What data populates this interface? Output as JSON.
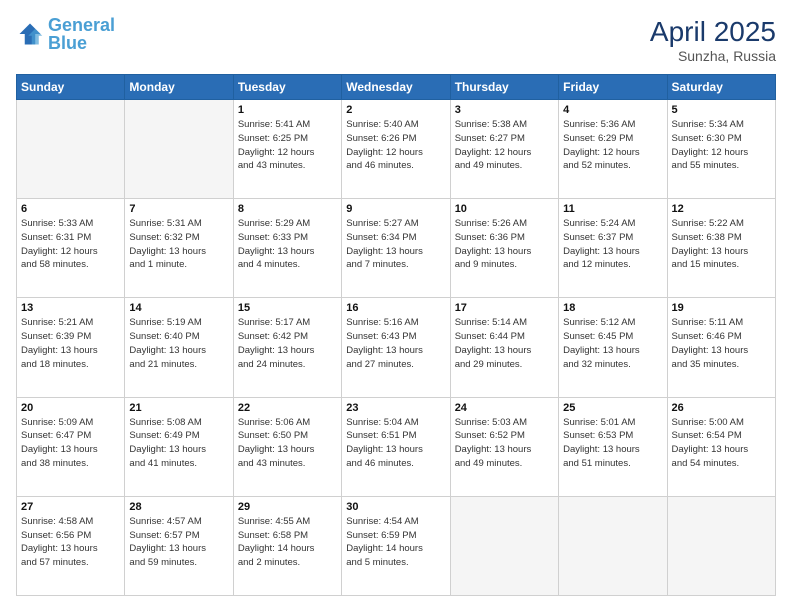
{
  "logo": {
    "line1": "General",
    "line2": "Blue"
  },
  "title": {
    "month_year": "April 2025",
    "location": "Sunzha, Russia"
  },
  "days_of_week": [
    "Sunday",
    "Monday",
    "Tuesday",
    "Wednesday",
    "Thursday",
    "Friday",
    "Saturday"
  ],
  "weeks": [
    [
      {
        "day": "",
        "info": ""
      },
      {
        "day": "",
        "info": ""
      },
      {
        "day": "1",
        "info": "Sunrise: 5:41 AM\nSunset: 6:25 PM\nDaylight: 12 hours\nand 43 minutes."
      },
      {
        "day": "2",
        "info": "Sunrise: 5:40 AM\nSunset: 6:26 PM\nDaylight: 12 hours\nand 46 minutes."
      },
      {
        "day": "3",
        "info": "Sunrise: 5:38 AM\nSunset: 6:27 PM\nDaylight: 12 hours\nand 49 minutes."
      },
      {
        "day": "4",
        "info": "Sunrise: 5:36 AM\nSunset: 6:29 PM\nDaylight: 12 hours\nand 52 minutes."
      },
      {
        "day": "5",
        "info": "Sunrise: 5:34 AM\nSunset: 6:30 PM\nDaylight: 12 hours\nand 55 minutes."
      }
    ],
    [
      {
        "day": "6",
        "info": "Sunrise: 5:33 AM\nSunset: 6:31 PM\nDaylight: 12 hours\nand 58 minutes."
      },
      {
        "day": "7",
        "info": "Sunrise: 5:31 AM\nSunset: 6:32 PM\nDaylight: 13 hours\nand 1 minute."
      },
      {
        "day": "8",
        "info": "Sunrise: 5:29 AM\nSunset: 6:33 PM\nDaylight: 13 hours\nand 4 minutes."
      },
      {
        "day": "9",
        "info": "Sunrise: 5:27 AM\nSunset: 6:34 PM\nDaylight: 13 hours\nand 7 minutes."
      },
      {
        "day": "10",
        "info": "Sunrise: 5:26 AM\nSunset: 6:36 PM\nDaylight: 13 hours\nand 9 minutes."
      },
      {
        "day": "11",
        "info": "Sunrise: 5:24 AM\nSunset: 6:37 PM\nDaylight: 13 hours\nand 12 minutes."
      },
      {
        "day": "12",
        "info": "Sunrise: 5:22 AM\nSunset: 6:38 PM\nDaylight: 13 hours\nand 15 minutes."
      }
    ],
    [
      {
        "day": "13",
        "info": "Sunrise: 5:21 AM\nSunset: 6:39 PM\nDaylight: 13 hours\nand 18 minutes."
      },
      {
        "day": "14",
        "info": "Sunrise: 5:19 AM\nSunset: 6:40 PM\nDaylight: 13 hours\nand 21 minutes."
      },
      {
        "day": "15",
        "info": "Sunrise: 5:17 AM\nSunset: 6:42 PM\nDaylight: 13 hours\nand 24 minutes."
      },
      {
        "day": "16",
        "info": "Sunrise: 5:16 AM\nSunset: 6:43 PM\nDaylight: 13 hours\nand 27 minutes."
      },
      {
        "day": "17",
        "info": "Sunrise: 5:14 AM\nSunset: 6:44 PM\nDaylight: 13 hours\nand 29 minutes."
      },
      {
        "day": "18",
        "info": "Sunrise: 5:12 AM\nSunset: 6:45 PM\nDaylight: 13 hours\nand 32 minutes."
      },
      {
        "day": "19",
        "info": "Sunrise: 5:11 AM\nSunset: 6:46 PM\nDaylight: 13 hours\nand 35 minutes."
      }
    ],
    [
      {
        "day": "20",
        "info": "Sunrise: 5:09 AM\nSunset: 6:47 PM\nDaylight: 13 hours\nand 38 minutes."
      },
      {
        "day": "21",
        "info": "Sunrise: 5:08 AM\nSunset: 6:49 PM\nDaylight: 13 hours\nand 41 minutes."
      },
      {
        "day": "22",
        "info": "Sunrise: 5:06 AM\nSunset: 6:50 PM\nDaylight: 13 hours\nand 43 minutes."
      },
      {
        "day": "23",
        "info": "Sunrise: 5:04 AM\nSunset: 6:51 PM\nDaylight: 13 hours\nand 46 minutes."
      },
      {
        "day": "24",
        "info": "Sunrise: 5:03 AM\nSunset: 6:52 PM\nDaylight: 13 hours\nand 49 minutes."
      },
      {
        "day": "25",
        "info": "Sunrise: 5:01 AM\nSunset: 6:53 PM\nDaylight: 13 hours\nand 51 minutes."
      },
      {
        "day": "26",
        "info": "Sunrise: 5:00 AM\nSunset: 6:54 PM\nDaylight: 13 hours\nand 54 minutes."
      }
    ],
    [
      {
        "day": "27",
        "info": "Sunrise: 4:58 AM\nSunset: 6:56 PM\nDaylight: 13 hours\nand 57 minutes."
      },
      {
        "day": "28",
        "info": "Sunrise: 4:57 AM\nSunset: 6:57 PM\nDaylight: 13 hours\nand 59 minutes."
      },
      {
        "day": "29",
        "info": "Sunrise: 4:55 AM\nSunset: 6:58 PM\nDaylight: 14 hours\nand 2 minutes."
      },
      {
        "day": "30",
        "info": "Sunrise: 4:54 AM\nSunset: 6:59 PM\nDaylight: 14 hours\nand 5 minutes."
      },
      {
        "day": "",
        "info": ""
      },
      {
        "day": "",
        "info": ""
      },
      {
        "day": "",
        "info": ""
      }
    ]
  ]
}
